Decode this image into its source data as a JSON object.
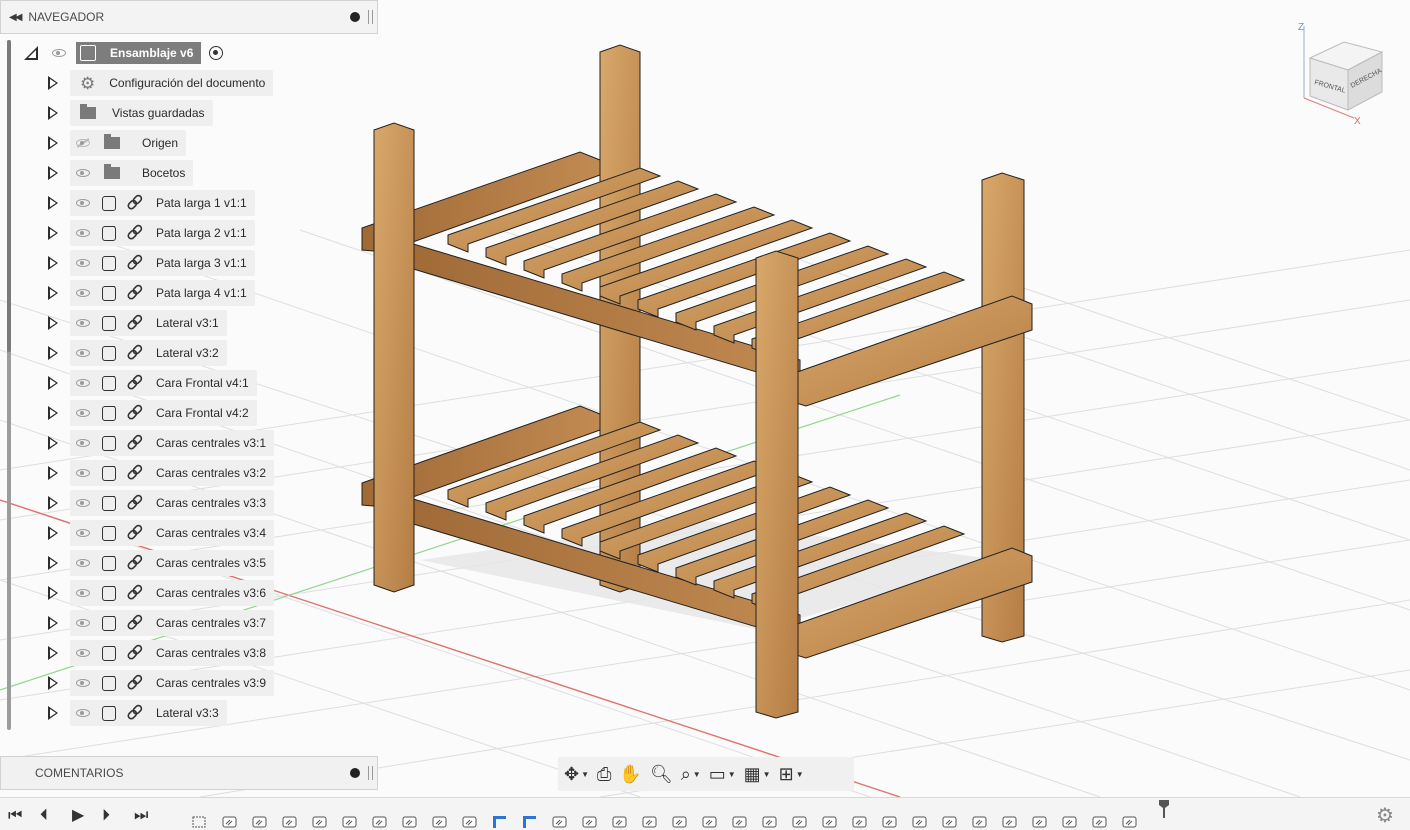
{
  "browser": {
    "header_title": "NAVEGADOR",
    "root": {
      "label": "Ensamblaje v6"
    },
    "items": [
      {
        "label": "Configuración del documento",
        "icon": "gear-icon",
        "visible": true
      },
      {
        "label": "Vistas guardadas",
        "icon": "folder-icon",
        "visible": true
      },
      {
        "label": "Origen",
        "icon": "folder-icon",
        "visible": false
      },
      {
        "label": "Bocetos",
        "icon": "folder-icon",
        "visible": true
      },
      {
        "label": "Pata larga 1 v1:1",
        "icon": "component-icon"
      },
      {
        "label": "Pata larga 2 v1:1",
        "icon": "component-icon"
      },
      {
        "label": "Pata larga 3 v1:1",
        "icon": "component-icon"
      },
      {
        "label": "Pata larga 4 v1:1",
        "icon": "component-icon"
      },
      {
        "label": "Lateral v3:1",
        "icon": "component-icon"
      },
      {
        "label": "Lateral v3:2",
        "icon": "component-icon"
      },
      {
        "label": "Cara Frontal v4:1",
        "icon": "component-icon"
      },
      {
        "label": "Cara Frontal v4:2",
        "icon": "component-icon"
      },
      {
        "label": "Caras centrales v3:1",
        "icon": "component-icon"
      },
      {
        "label": "Caras centrales v3:2",
        "icon": "component-icon"
      },
      {
        "label": "Caras centrales v3:3",
        "icon": "component-icon"
      },
      {
        "label": "Caras centrales v3:4",
        "icon": "component-icon"
      },
      {
        "label": "Caras centrales v3:5",
        "icon": "component-icon"
      },
      {
        "label": "Caras centrales v3:6",
        "icon": "component-icon"
      },
      {
        "label": "Caras centrales v3:7",
        "icon": "component-icon"
      },
      {
        "label": "Caras centrales v3:8",
        "icon": "component-icon"
      },
      {
        "label": "Caras centrales v3:9",
        "icon": "component-icon"
      },
      {
        "label": "Lateral v3:3",
        "icon": "component-icon"
      }
    ]
  },
  "comments": {
    "header_title": "COMENTARIOS"
  },
  "viewcube": {
    "face_front": "FRONTAL",
    "face_right": "DERECHA",
    "axis_z": "Z",
    "axis_x": "X"
  },
  "navbar": {
    "tools": [
      "orbit-icon",
      "look-at-icon",
      "pan-icon",
      "zoom-icon",
      "fit-icon",
      "display-settings-icon",
      "grid-icon",
      "viewports-icon"
    ]
  },
  "timeline": {
    "controls": [
      "go-to-start-icon",
      "step-back-icon",
      "play-icon",
      "step-forward-icon",
      "go-to-end-icon"
    ],
    "feature_count": 32
  },
  "colors": {
    "wood": "#c8955a",
    "wood_dark": "#8a5f33",
    "grid": "#d9d9d9",
    "axis_red": "#e07070",
    "axis_green": "#7fd17f",
    "panel_bg": "#efefef"
  }
}
